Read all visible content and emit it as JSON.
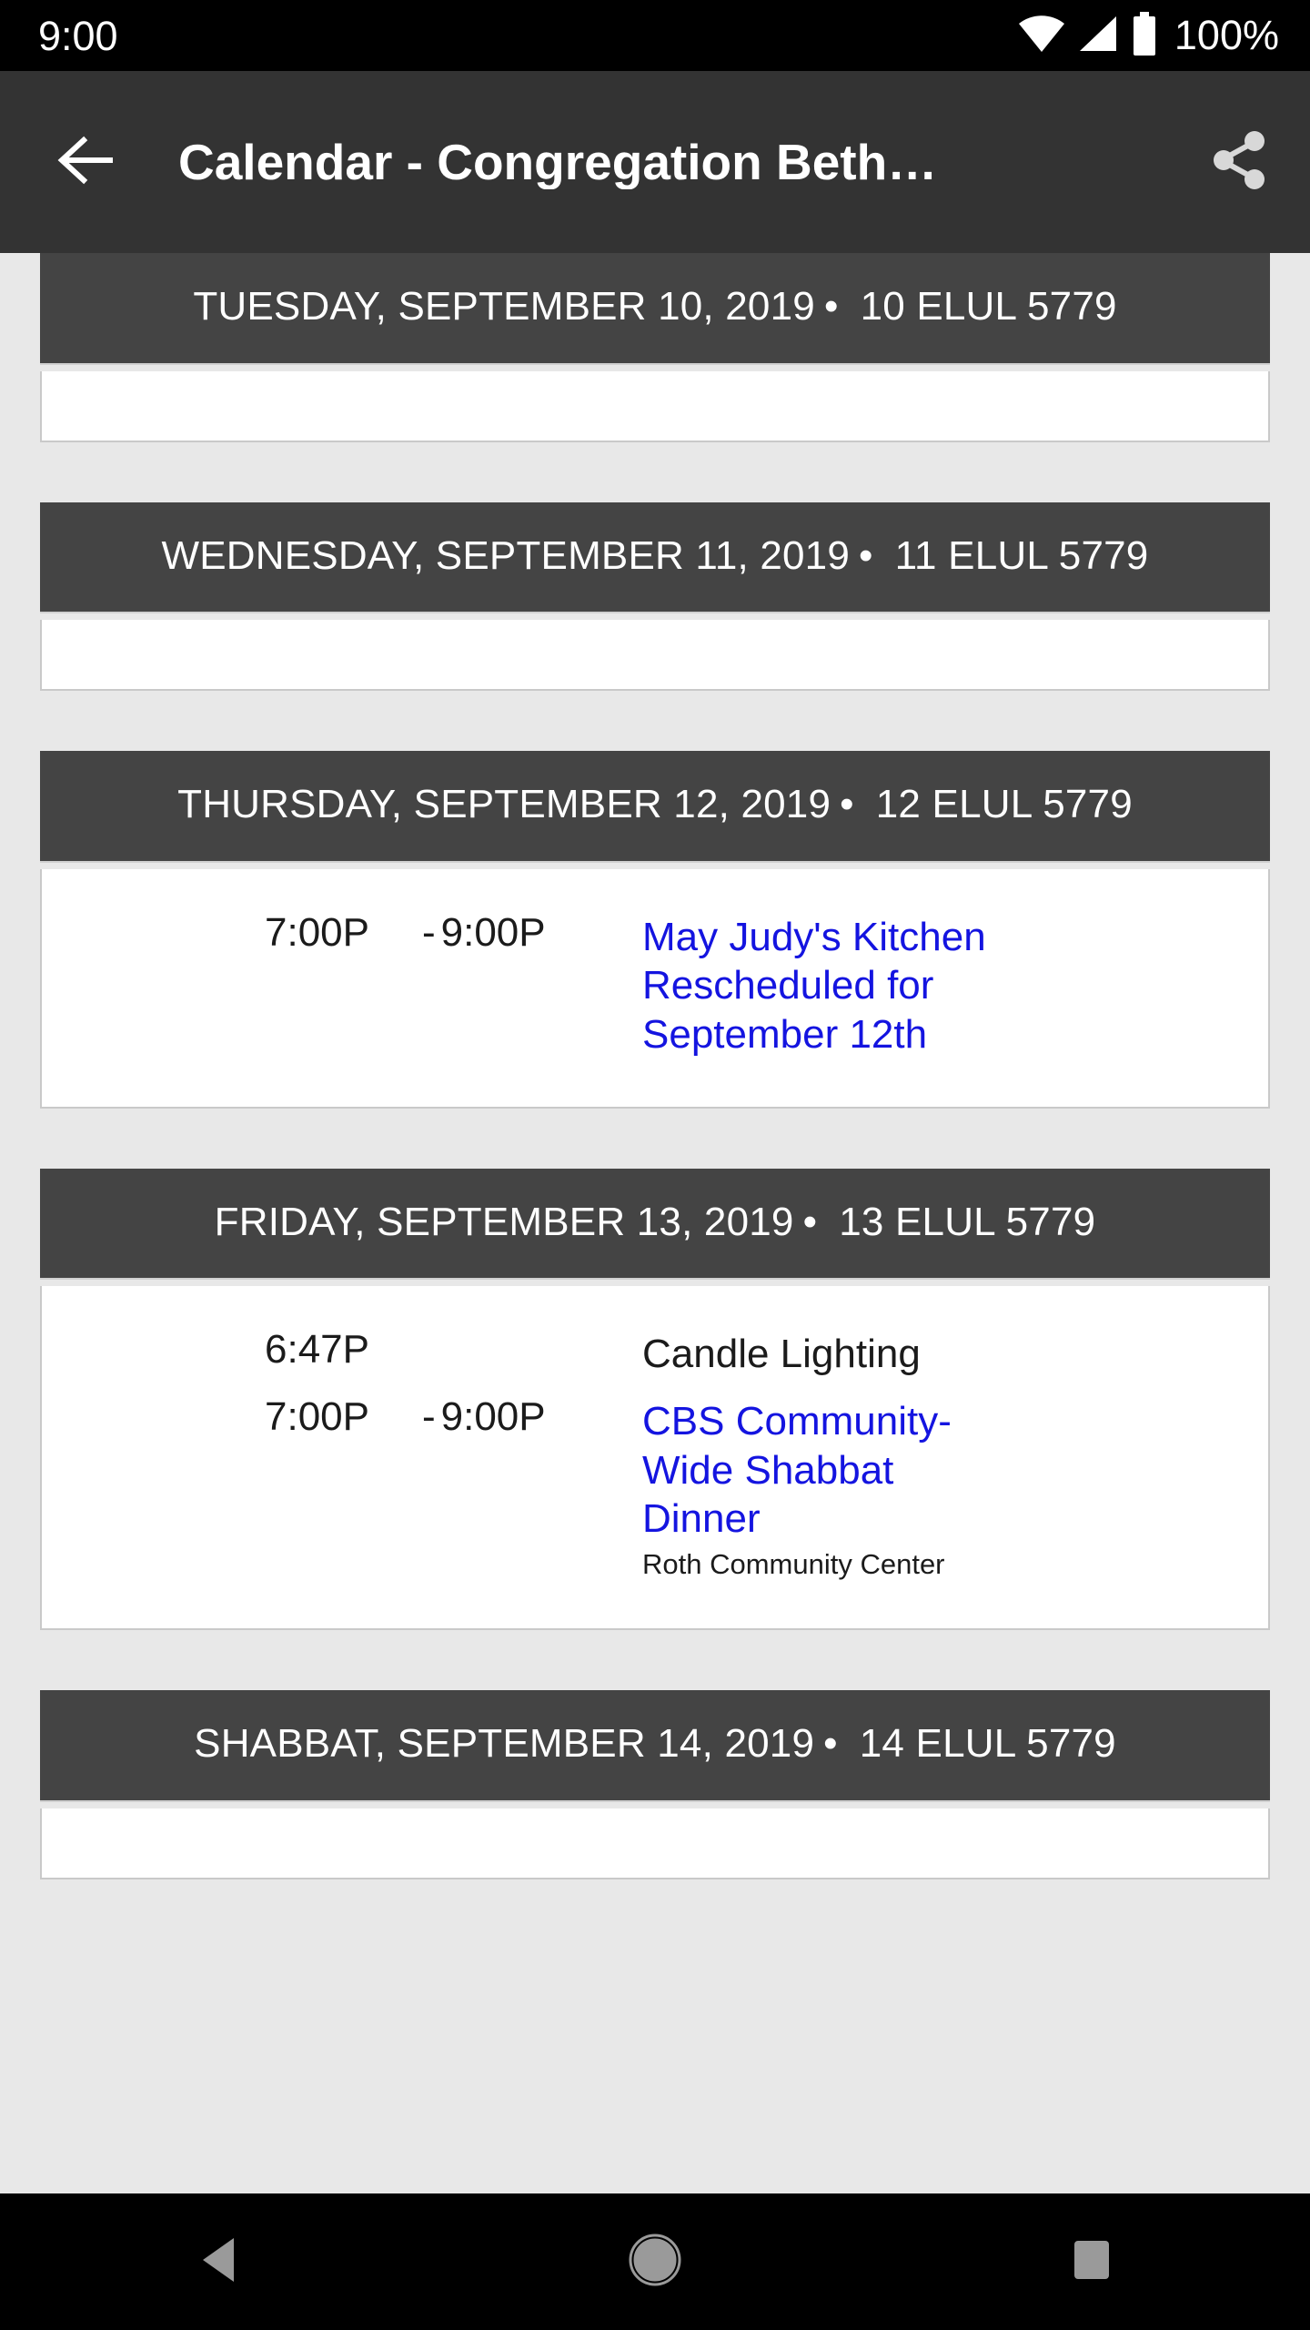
{
  "status_bar": {
    "clock": "9:00",
    "battery_percent": "100%",
    "icons": [
      "wifi-icon",
      "cell-signal-icon",
      "battery-full-icon"
    ]
  },
  "app_bar": {
    "back_icon": "back-arrow-icon",
    "title": "Calendar - Congregation Beth…",
    "share_icon": "share-icon"
  },
  "colors": {
    "status_bar_bg": "#000000",
    "app_bar_bg": "#333333",
    "day_header_bg": "#444444",
    "page_bg": "#e8e8e8",
    "card_bg": "#ffffff",
    "link": "#1414e0",
    "text": "#1b1b1b"
  },
  "days": [
    {
      "gregorian": "TUESDAY, SEPTEMBER 10, 2019",
      "separator": "•",
      "hebrew": "10 ELUL 5779",
      "events": []
    },
    {
      "gregorian": "WEDNESDAY, SEPTEMBER 11, 2019",
      "separator": "•",
      "hebrew": "11 ELUL 5779",
      "events": []
    },
    {
      "gregorian": "THURSDAY, SEPTEMBER 12, 2019",
      "separator": "•",
      "hebrew": "12 ELUL 5779",
      "events": [
        {
          "start": "7:00P",
          "sep": "-",
          "end": "9:00P",
          "title": "May Judy's Kitchen Rescheduled for September 12th",
          "is_link": true,
          "location": ""
        }
      ]
    },
    {
      "gregorian": "FRIDAY, SEPTEMBER 13, 2019",
      "separator": "•",
      "hebrew": "13 ELUL 5779",
      "events": [
        {
          "start": "6:47P",
          "sep": "",
          "end": "",
          "title": "Candle Lighting",
          "is_link": false,
          "location": ""
        },
        {
          "start": "7:00P",
          "sep": "-",
          "end": "9:00P",
          "title": "CBS Community-Wide Shabbat Dinner",
          "is_link": true,
          "location": "Roth Community Center"
        }
      ]
    },
    {
      "gregorian": "SHABBAT, SEPTEMBER 14, 2019",
      "separator": "•",
      "hebrew": "14 ELUL 5779",
      "events": []
    }
  ],
  "nav_bar": {
    "back_label": "back-triangle-icon",
    "home_label": "home-circle-icon",
    "recents_label": "recents-square-icon"
  }
}
